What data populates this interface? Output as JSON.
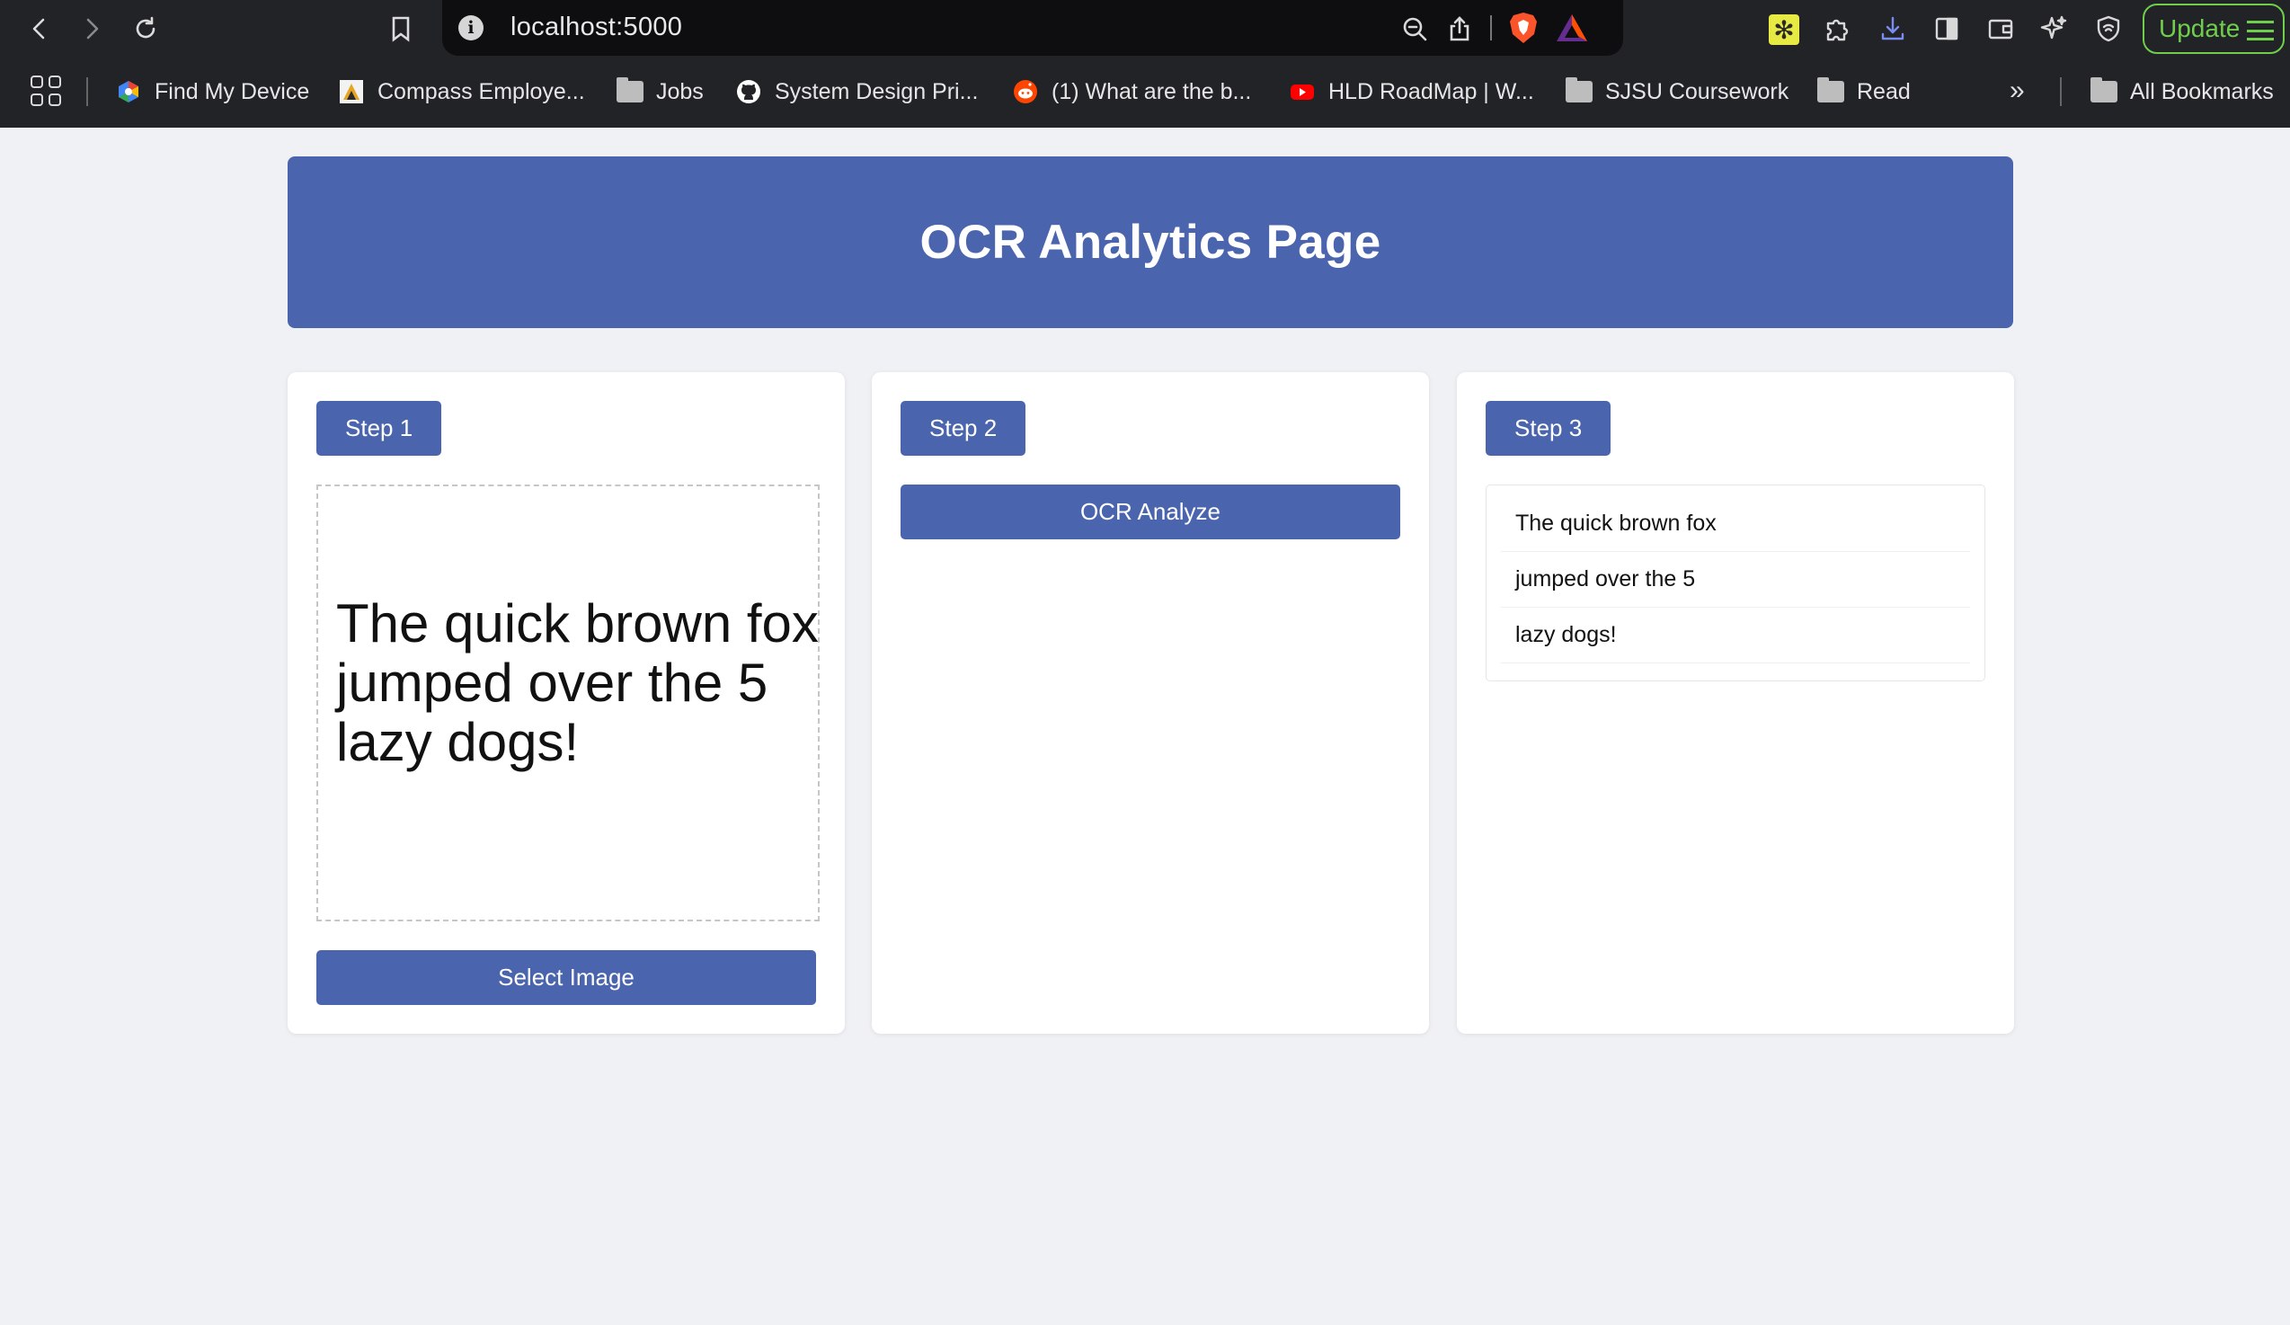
{
  "browser": {
    "url": "localhost:5000",
    "update_label": "Update",
    "bookmarks": [
      {
        "label": "Find My Device",
        "icon": "google-find-my-device-icon"
      },
      {
        "label": "Compass Employe...",
        "icon": "compass-icon"
      },
      {
        "label": "Jobs",
        "icon": "folder-icon"
      },
      {
        "label": "System Design Pri...",
        "icon": "github-icon"
      },
      {
        "label": "(1) What are the b...",
        "icon": "reddit-icon"
      },
      {
        "label": "HLD RoadMap | W...",
        "icon": "youtube-icon"
      },
      {
        "label": "SJSU Coursework",
        "icon": "folder-icon"
      },
      {
        "label": "Read",
        "icon": "folder-icon"
      }
    ],
    "all_bookmarks_label": "All Bookmarks",
    "more_label": "»"
  },
  "page": {
    "title": "OCR Analytics Page",
    "accent_color": "#4a65ae",
    "background_color": "#f0f1f5"
  },
  "step1": {
    "badge": "Step 1",
    "preview_lines": [
      "The quick brown fox",
      "jumped over the 5",
      "lazy dogs!"
    ],
    "select_button": "Select Image"
  },
  "step2": {
    "badge": "Step 2",
    "analyze_button": "OCR Analyze"
  },
  "step3": {
    "badge": "Step 3",
    "results": [
      "The quick brown fox",
      "jumped over the 5",
      "lazy dogs!"
    ]
  }
}
